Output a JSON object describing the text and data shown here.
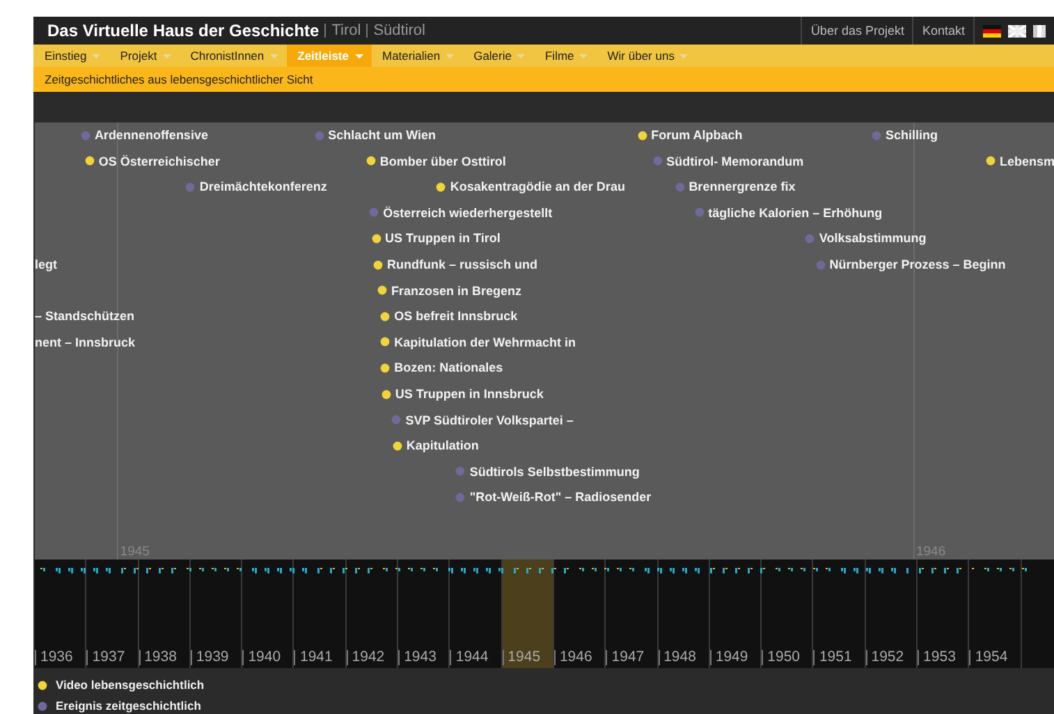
{
  "header": {
    "title": "Das Virtuelle Haus der Geschichte",
    "regions": [
      "Tirol",
      "Südtirol"
    ],
    "links": [
      "Über das Projekt",
      "Kontakt"
    ]
  },
  "nav": [
    {
      "label": "Einstieg",
      "selected": false
    },
    {
      "label": "Projekt",
      "selected": false
    },
    {
      "label": "ChronistInnen",
      "selected": false
    },
    {
      "label": "Zeitleiste",
      "selected": true
    },
    {
      "label": "Materialien",
      "selected": false
    },
    {
      "label": "Galerie",
      "selected": false
    },
    {
      "label": "Filme",
      "selected": false
    },
    {
      "label": "Wir über uns",
      "selected": false
    }
  ],
  "subtitle": "Zeitgeschichtliches aus lebensgeschichtlicher Sicht",
  "timeline": {
    "axis": [
      "1945",
      "1946"
    ],
    "events": [
      {
        "label": "Ardennenoffensive",
        "kind": "event"
      },
      {
        "label": "Schlacht um Wien",
        "kind": "event"
      },
      {
        "label": "Forum Alpbach",
        "kind": "video"
      },
      {
        "label": "Schilling",
        "kind": "event"
      },
      {
        "label": "OS Österreichischer",
        "kind": "video"
      },
      {
        "label": "Bomber über Osttirol",
        "kind": "video"
      },
      {
        "label": "Südtirol- Memorandum",
        "kind": "event"
      },
      {
        "label": "Lebensm",
        "kind": "video"
      },
      {
        "label": "Dreimächtekonferenz",
        "kind": "event"
      },
      {
        "label": "Kosakentragödie an der Drau",
        "kind": "video"
      },
      {
        "label": "Brennergrenze fix",
        "kind": "event"
      },
      {
        "label": "Österreich wiederhergestellt",
        "kind": "event"
      },
      {
        "label": "tägliche Kalorien – Erhöhung",
        "kind": "event"
      },
      {
        "label": "US Truppen in Tirol",
        "kind": "video"
      },
      {
        "label": "Volksabstimmung",
        "kind": "event"
      },
      {
        "label": "legt",
        "kind": "clipped"
      },
      {
        "label": "Rundfunk – russisch und",
        "kind": "video"
      },
      {
        "label": "Nürnberger Prozess – Beginn",
        "kind": "event"
      },
      {
        "label": "Franzosen in Bregenz",
        "kind": "video"
      },
      {
        "label": "– Standschützen",
        "kind": "clipped"
      },
      {
        "label": "OS befreit Innsbruck",
        "kind": "video"
      },
      {
        "label": "nent – Innsbruck",
        "kind": "clipped"
      },
      {
        "label": "Kapitulation der Wehrmacht in",
        "kind": "video"
      },
      {
        "label": "Bozen: Nationales",
        "kind": "video"
      },
      {
        "label": "US Truppen in Innsbruck",
        "kind": "video"
      },
      {
        "label": "SVP Südtiroler Volkspartei –",
        "kind": "event"
      },
      {
        "label": "Kapitulation",
        "kind": "video"
      },
      {
        "label": "Südtirols Selbstbestimmung",
        "kind": "event"
      },
      {
        "label": "\"Rot-Weiß-Rot\" – Radiosender",
        "kind": "event"
      }
    ]
  },
  "overview": {
    "years": [
      {
        "label": "1936",
        "selected": false
      },
      {
        "label": "1937",
        "selected": false
      },
      {
        "label": "1938",
        "selected": false
      },
      {
        "label": "1939",
        "selected": false
      },
      {
        "label": "1940",
        "selected": false
      },
      {
        "label": "1941",
        "selected": false
      },
      {
        "label": "1942",
        "selected": false
      },
      {
        "label": "1943",
        "selected": false
      },
      {
        "label": "1944",
        "selected": false
      },
      {
        "label": "1945",
        "selected": true
      },
      {
        "label": "1946",
        "selected": false
      },
      {
        "label": "1947",
        "selected": false
      },
      {
        "label": "1948",
        "selected": false
      },
      {
        "label": "1949",
        "selected": false
      },
      {
        "label": "1950",
        "selected": false
      },
      {
        "label": "1951",
        "selected": false
      },
      {
        "label": "1952",
        "selected": false
      },
      {
        "label": "1953",
        "selected": false
      },
      {
        "label": "1954",
        "selected": false
      }
    ]
  },
  "legend": [
    {
      "label": "Video lebensgeschichtlich",
      "kind": "video"
    },
    {
      "label": "Ereignis zeitgeschichtlich",
      "kind": "event"
    }
  ]
}
